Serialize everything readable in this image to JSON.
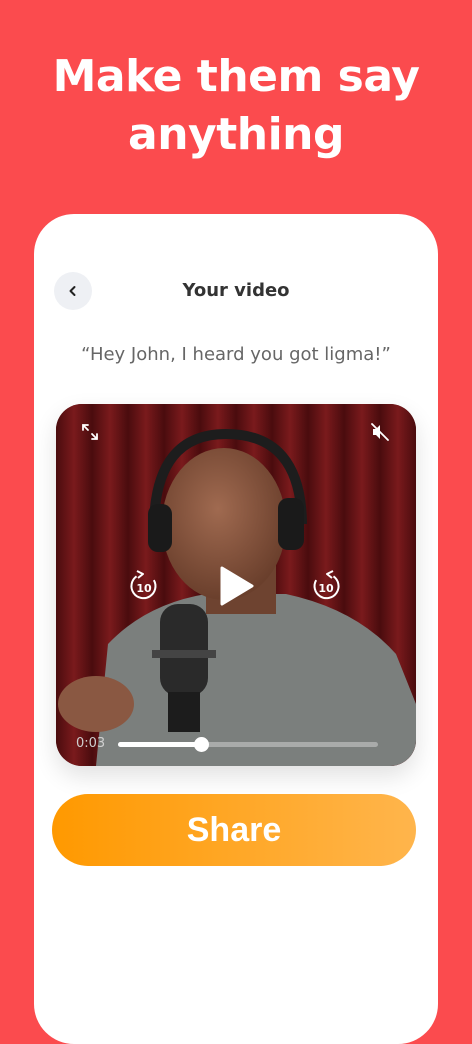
{
  "headline": "Make them say anything",
  "screen": {
    "title": "Your video",
    "quote": "“Hey John, I heard you got ligma!”"
  },
  "player": {
    "current_time": "0:03",
    "progress": 0.32,
    "skip_back_label": "10",
    "skip_forward_label": "10",
    "muted": true
  },
  "share_button": {
    "label": "Share"
  },
  "colors": {
    "background": "#fb4b4e",
    "share_gradient_start": "#ff9900",
    "share_gradient_end": "#ffb54c"
  },
  "icons": [
    "chevron-left-icon",
    "expand-icon",
    "mute-icon",
    "replay-10-icon",
    "play-icon",
    "forward-10-icon"
  ]
}
